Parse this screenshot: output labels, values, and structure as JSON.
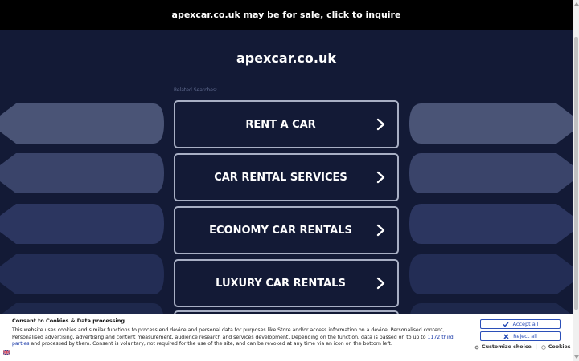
{
  "topbar": {
    "text": "apexcar.co.uk may be for sale, click to inquire"
  },
  "site": {
    "title": "apexcar.co.uk"
  },
  "related": {
    "label": "Related Searches:"
  },
  "searches": [
    {
      "label": "RENT A CAR"
    },
    {
      "label": "CAR RENTAL SERVICES"
    },
    {
      "label": "ECONOMY CAR RENTALS"
    },
    {
      "label": "LUXURY CAR RENTALS"
    }
  ],
  "consent": {
    "title": "Consent to Cookies & Data processing",
    "text_part1": "This website uses cookies and similar functions to process end device and personal data for purposes like Store and/or access information on a device, Personalised content, Personalised advertising, advertising and content measurement, audience research and services development. Depending on the function, data is passed on to up to ",
    "link_text": "1172 third parties",
    "text_part2": " and processed by them. Consent is voluntary, not required for the use of the site, and can be revoked at any time via an icon on the bottom left.",
    "accept_label": "Accept all",
    "reject_label": "Reject all",
    "customize_label": "Customize choice",
    "separator": "|",
    "cookies_label": "Cookies"
  },
  "colors": {
    "background": "#131a36",
    "topbar": "#000000",
    "button_border": "#a8afc4",
    "consent_accent": "#2b4fb8"
  },
  "icons": {
    "search_chevron": "chevron-right-icon",
    "accept": "check-icon",
    "reject": "x-icon",
    "customize": "gear-icon",
    "cookies": "cookie-icon",
    "flag": "uk-flag-icon"
  }
}
